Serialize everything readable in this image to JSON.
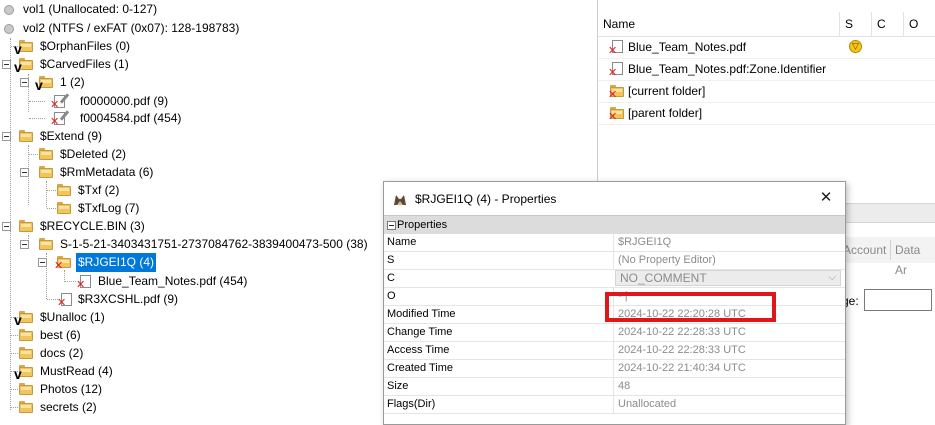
{
  "tree": [
    {
      "label": "vol1 (Unallocated: 0-127)",
      "icon": "disk",
      "mark": ""
    },
    {
      "label": "vol2 (NTFS / exFAT (0x07): 128-198783)",
      "icon": "disk",
      "mark": ""
    },
    {
      "label": "$OrphanFiles (0)",
      "icon": "folder",
      "mark": "v"
    },
    {
      "label": "$CarvedFiles (1)",
      "icon": "folder",
      "mark": "v"
    },
    {
      "label": "1 (2)",
      "icon": "folder",
      "mark": "v"
    },
    {
      "label": "f0000000.pdf (9)",
      "icon": "doc",
      "mark": "x"
    },
    {
      "label": "f0004584.pdf (454)",
      "icon": "doc",
      "mark": "x"
    },
    {
      "label": "$Extend (9)",
      "icon": "folder",
      "mark": ""
    },
    {
      "label": "$Deleted (2)",
      "icon": "folder",
      "mark": ""
    },
    {
      "label": "$RmMetadata (6)",
      "icon": "folder",
      "mark": ""
    },
    {
      "label": "$Txf (2)",
      "icon": "folder",
      "mark": ""
    },
    {
      "label": "$TxfLog (7)",
      "icon": "folder",
      "mark": ""
    },
    {
      "label": "$RECYCLE.BIN (3)",
      "icon": "folder",
      "mark": ""
    },
    {
      "label": "S-1-5-21-3403431751-2737084762-3839400473-500 (38)",
      "icon": "folder",
      "mark": ""
    },
    {
      "label": "$RJGEI1Q (4)",
      "icon": "folder",
      "mark": "x"
    },
    {
      "label": "Blue_Team_Notes.pdf (454)",
      "icon": "doc",
      "mark": "x"
    },
    {
      "label": "$R3XCSHL.pdf (9)",
      "icon": "doc",
      "mark": "x"
    },
    {
      "label": "$Unalloc (1)",
      "icon": "folder",
      "mark": "v"
    },
    {
      "label": "best (6)",
      "icon": "folder",
      "mark": ""
    },
    {
      "label": "docs (2)",
      "icon": "folder",
      "mark": ""
    },
    {
      "label": "MustRead (4)",
      "icon": "folder",
      "mark": "v"
    },
    {
      "label": "Photos (12)",
      "icon": "folder",
      "mark": ""
    },
    {
      "label": "secrets (2)",
      "icon": "folder",
      "mark": ""
    }
  ],
  "list": {
    "columns": [
      "Name",
      "S",
      "C",
      "O"
    ],
    "rows": [
      {
        "name": "Blue_Team_Notes.pdf",
        "icon": "doc",
        "status": "warning"
      },
      {
        "name": "Blue_Team_Notes.pdf:Zone.Identifier",
        "icon": "doc",
        "status": ""
      },
      {
        "name": "[current folder]",
        "icon": "folder",
        "status": ""
      },
      {
        "name": "[parent folder]",
        "icon": "folder",
        "status": ""
      }
    ],
    "tabs": [
      "Account",
      "Data Ar"
    ],
    "page_label": "ge:"
  },
  "dialog": {
    "title": "$RJGEI1Q (4) - Properties",
    "section": "Properties",
    "close_glyph": "✕",
    "rows": [
      {
        "key": "Name",
        "value": "$RJGEI1Q"
      },
      {
        "key": "S",
        "value": "(No Property Editor)"
      },
      {
        "key": "C",
        "value": "NO_COMMENT"
      },
      {
        "key": "O",
        "value": "- |"
      },
      {
        "key": "Modified Time",
        "value": "2024-10-22 22:20:28 UTC"
      },
      {
        "key": "Change Time",
        "value": "2024-10-22 22:28:33 UTC"
      },
      {
        "key": "Access Time",
        "value": "2024-10-22 22:28:33 UTC"
      },
      {
        "key": "Created Time",
        "value": "2024-10-22 21:40:34 UTC"
      },
      {
        "key": "Size",
        "value": "48"
      },
      {
        "key": "Flags(Dir)",
        "value": "Unallocated"
      }
    ]
  },
  "colors": {
    "selection": "#0078d7",
    "highlight_box": "#e0161b",
    "folder": "#f2c55c",
    "deleted_mark": "#e32020"
  }
}
